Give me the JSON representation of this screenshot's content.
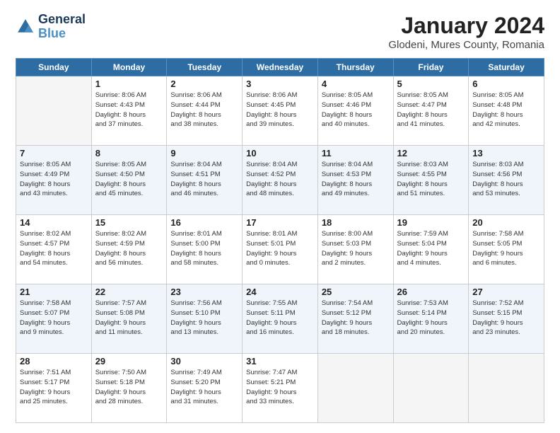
{
  "header": {
    "logo": {
      "line1": "General",
      "line2": "Blue"
    },
    "title": "January 2024",
    "subtitle": "Glodeni, Mures County, Romania"
  },
  "days_of_week": [
    "Sunday",
    "Monday",
    "Tuesday",
    "Wednesday",
    "Thursday",
    "Friday",
    "Saturday"
  ],
  "weeks": [
    [
      {
        "day": "",
        "info": ""
      },
      {
        "day": "1",
        "info": "Sunrise: 8:06 AM\nSunset: 4:43 PM\nDaylight: 8 hours\nand 37 minutes."
      },
      {
        "day": "2",
        "info": "Sunrise: 8:06 AM\nSunset: 4:44 PM\nDaylight: 8 hours\nand 38 minutes."
      },
      {
        "day": "3",
        "info": "Sunrise: 8:06 AM\nSunset: 4:45 PM\nDaylight: 8 hours\nand 39 minutes."
      },
      {
        "day": "4",
        "info": "Sunrise: 8:05 AM\nSunset: 4:46 PM\nDaylight: 8 hours\nand 40 minutes."
      },
      {
        "day": "5",
        "info": "Sunrise: 8:05 AM\nSunset: 4:47 PM\nDaylight: 8 hours\nand 41 minutes."
      },
      {
        "day": "6",
        "info": "Sunrise: 8:05 AM\nSunset: 4:48 PM\nDaylight: 8 hours\nand 42 minutes."
      }
    ],
    [
      {
        "day": "7",
        "info": "Sunrise: 8:05 AM\nSunset: 4:49 PM\nDaylight: 8 hours\nand 43 minutes."
      },
      {
        "day": "8",
        "info": "Sunrise: 8:05 AM\nSunset: 4:50 PM\nDaylight: 8 hours\nand 45 minutes."
      },
      {
        "day": "9",
        "info": "Sunrise: 8:04 AM\nSunset: 4:51 PM\nDaylight: 8 hours\nand 46 minutes."
      },
      {
        "day": "10",
        "info": "Sunrise: 8:04 AM\nSunset: 4:52 PM\nDaylight: 8 hours\nand 48 minutes."
      },
      {
        "day": "11",
        "info": "Sunrise: 8:04 AM\nSunset: 4:53 PM\nDaylight: 8 hours\nand 49 minutes."
      },
      {
        "day": "12",
        "info": "Sunrise: 8:03 AM\nSunset: 4:55 PM\nDaylight: 8 hours\nand 51 minutes."
      },
      {
        "day": "13",
        "info": "Sunrise: 8:03 AM\nSunset: 4:56 PM\nDaylight: 8 hours\nand 53 minutes."
      }
    ],
    [
      {
        "day": "14",
        "info": "Sunrise: 8:02 AM\nSunset: 4:57 PM\nDaylight: 8 hours\nand 54 minutes."
      },
      {
        "day": "15",
        "info": "Sunrise: 8:02 AM\nSunset: 4:59 PM\nDaylight: 8 hours\nand 56 minutes."
      },
      {
        "day": "16",
        "info": "Sunrise: 8:01 AM\nSunset: 5:00 PM\nDaylight: 8 hours\nand 58 minutes."
      },
      {
        "day": "17",
        "info": "Sunrise: 8:01 AM\nSunset: 5:01 PM\nDaylight: 9 hours\nand 0 minutes."
      },
      {
        "day": "18",
        "info": "Sunrise: 8:00 AM\nSunset: 5:03 PM\nDaylight: 9 hours\nand 2 minutes."
      },
      {
        "day": "19",
        "info": "Sunrise: 7:59 AM\nSunset: 5:04 PM\nDaylight: 9 hours\nand 4 minutes."
      },
      {
        "day": "20",
        "info": "Sunrise: 7:58 AM\nSunset: 5:05 PM\nDaylight: 9 hours\nand 6 minutes."
      }
    ],
    [
      {
        "day": "21",
        "info": "Sunrise: 7:58 AM\nSunset: 5:07 PM\nDaylight: 9 hours\nand 9 minutes."
      },
      {
        "day": "22",
        "info": "Sunrise: 7:57 AM\nSunset: 5:08 PM\nDaylight: 9 hours\nand 11 minutes."
      },
      {
        "day": "23",
        "info": "Sunrise: 7:56 AM\nSunset: 5:10 PM\nDaylight: 9 hours\nand 13 minutes."
      },
      {
        "day": "24",
        "info": "Sunrise: 7:55 AM\nSunset: 5:11 PM\nDaylight: 9 hours\nand 16 minutes."
      },
      {
        "day": "25",
        "info": "Sunrise: 7:54 AM\nSunset: 5:12 PM\nDaylight: 9 hours\nand 18 minutes."
      },
      {
        "day": "26",
        "info": "Sunrise: 7:53 AM\nSunset: 5:14 PM\nDaylight: 9 hours\nand 20 minutes."
      },
      {
        "day": "27",
        "info": "Sunrise: 7:52 AM\nSunset: 5:15 PM\nDaylight: 9 hours\nand 23 minutes."
      }
    ],
    [
      {
        "day": "28",
        "info": "Sunrise: 7:51 AM\nSunset: 5:17 PM\nDaylight: 9 hours\nand 25 minutes."
      },
      {
        "day": "29",
        "info": "Sunrise: 7:50 AM\nSunset: 5:18 PM\nDaylight: 9 hours\nand 28 minutes."
      },
      {
        "day": "30",
        "info": "Sunrise: 7:49 AM\nSunset: 5:20 PM\nDaylight: 9 hours\nand 31 minutes."
      },
      {
        "day": "31",
        "info": "Sunrise: 7:47 AM\nSunset: 5:21 PM\nDaylight: 9 hours\nand 33 minutes."
      },
      {
        "day": "",
        "info": ""
      },
      {
        "day": "",
        "info": ""
      },
      {
        "day": "",
        "info": ""
      }
    ]
  ]
}
